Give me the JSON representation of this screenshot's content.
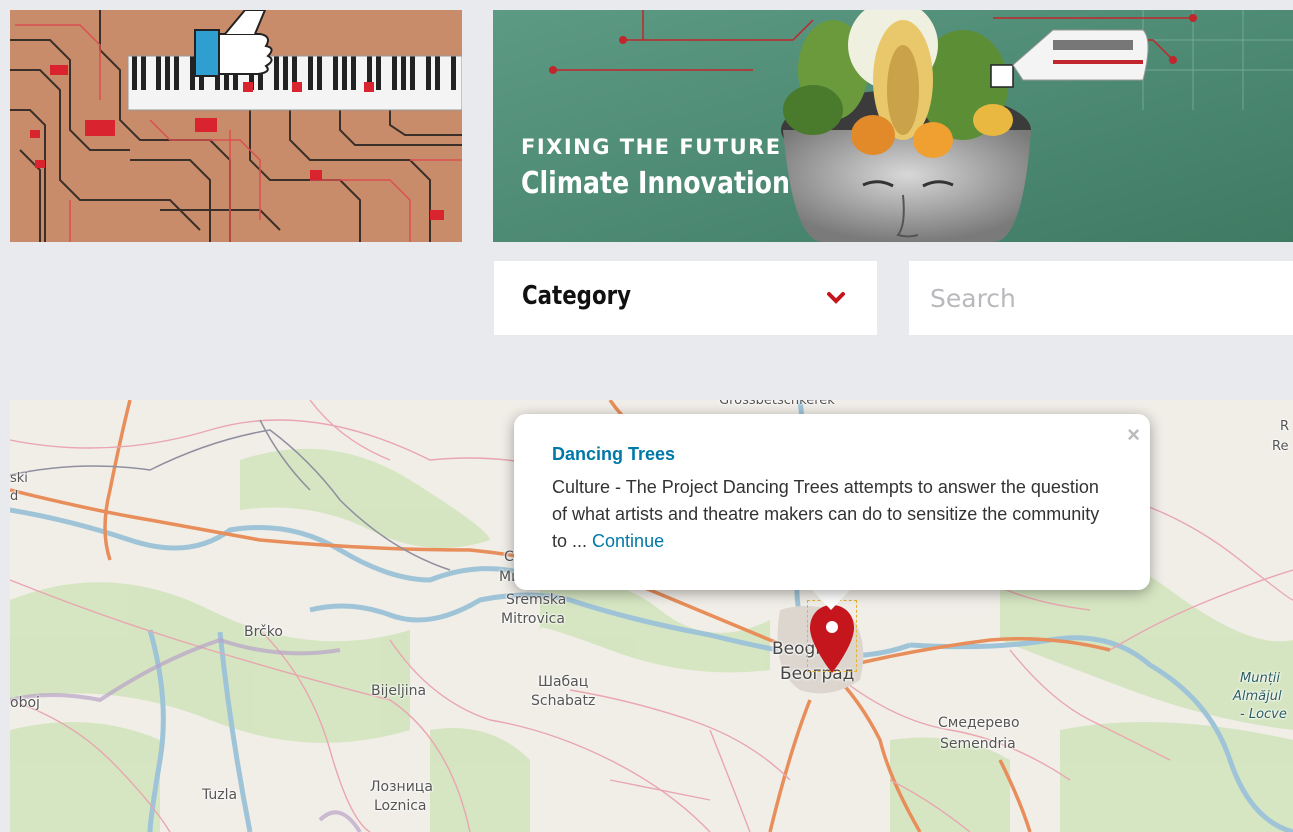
{
  "banner": {
    "kicker": "FIXING THE FUTURE",
    "headline": "Climate Innovation"
  },
  "filters": {
    "category_label": "Category",
    "search_placeholder": "Search"
  },
  "map": {
    "places": {
      "grossbetschkerek": "Grossbetschkerek",
      "ski": "ski",
      "d": "d",
      "re": "Re",
      "r": "R",
      "mi": "Ми",
      "c": "C",
      "sremska": "Sremska",
      "mitrovica": "Mitrovica",
      "brcko": "Brčko",
      "bijeljina": "Bijeljina",
      "sabac": "Шабац",
      "schabatz": "Schabatz",
      "beograd_lat": "Beograd",
      "beograd_cyr": "Београд",
      "smederevo": "Смедерево",
      "semendria": "Semendria",
      "doboj": "oboj",
      "tuzla": "Tuzla",
      "loznica_cyr": "Лозница",
      "loznica_lat": "Loznica",
      "muntii": "Munții",
      "almajului": "Almăjul",
      "locvei": "- Locve"
    }
  },
  "popup": {
    "title": "Dancing Trees",
    "description": "Culture - The Project Dancing Trees attempts to answer the question of what artists and theatre makers can do to sensitize the community to ... ",
    "continue_label": "Continue",
    "close_label": "×"
  },
  "colors": {
    "background": "#e9eaee",
    "accent_red": "#cc0000",
    "link_blue": "#0078a8",
    "banner_green": "#4f8a73"
  }
}
